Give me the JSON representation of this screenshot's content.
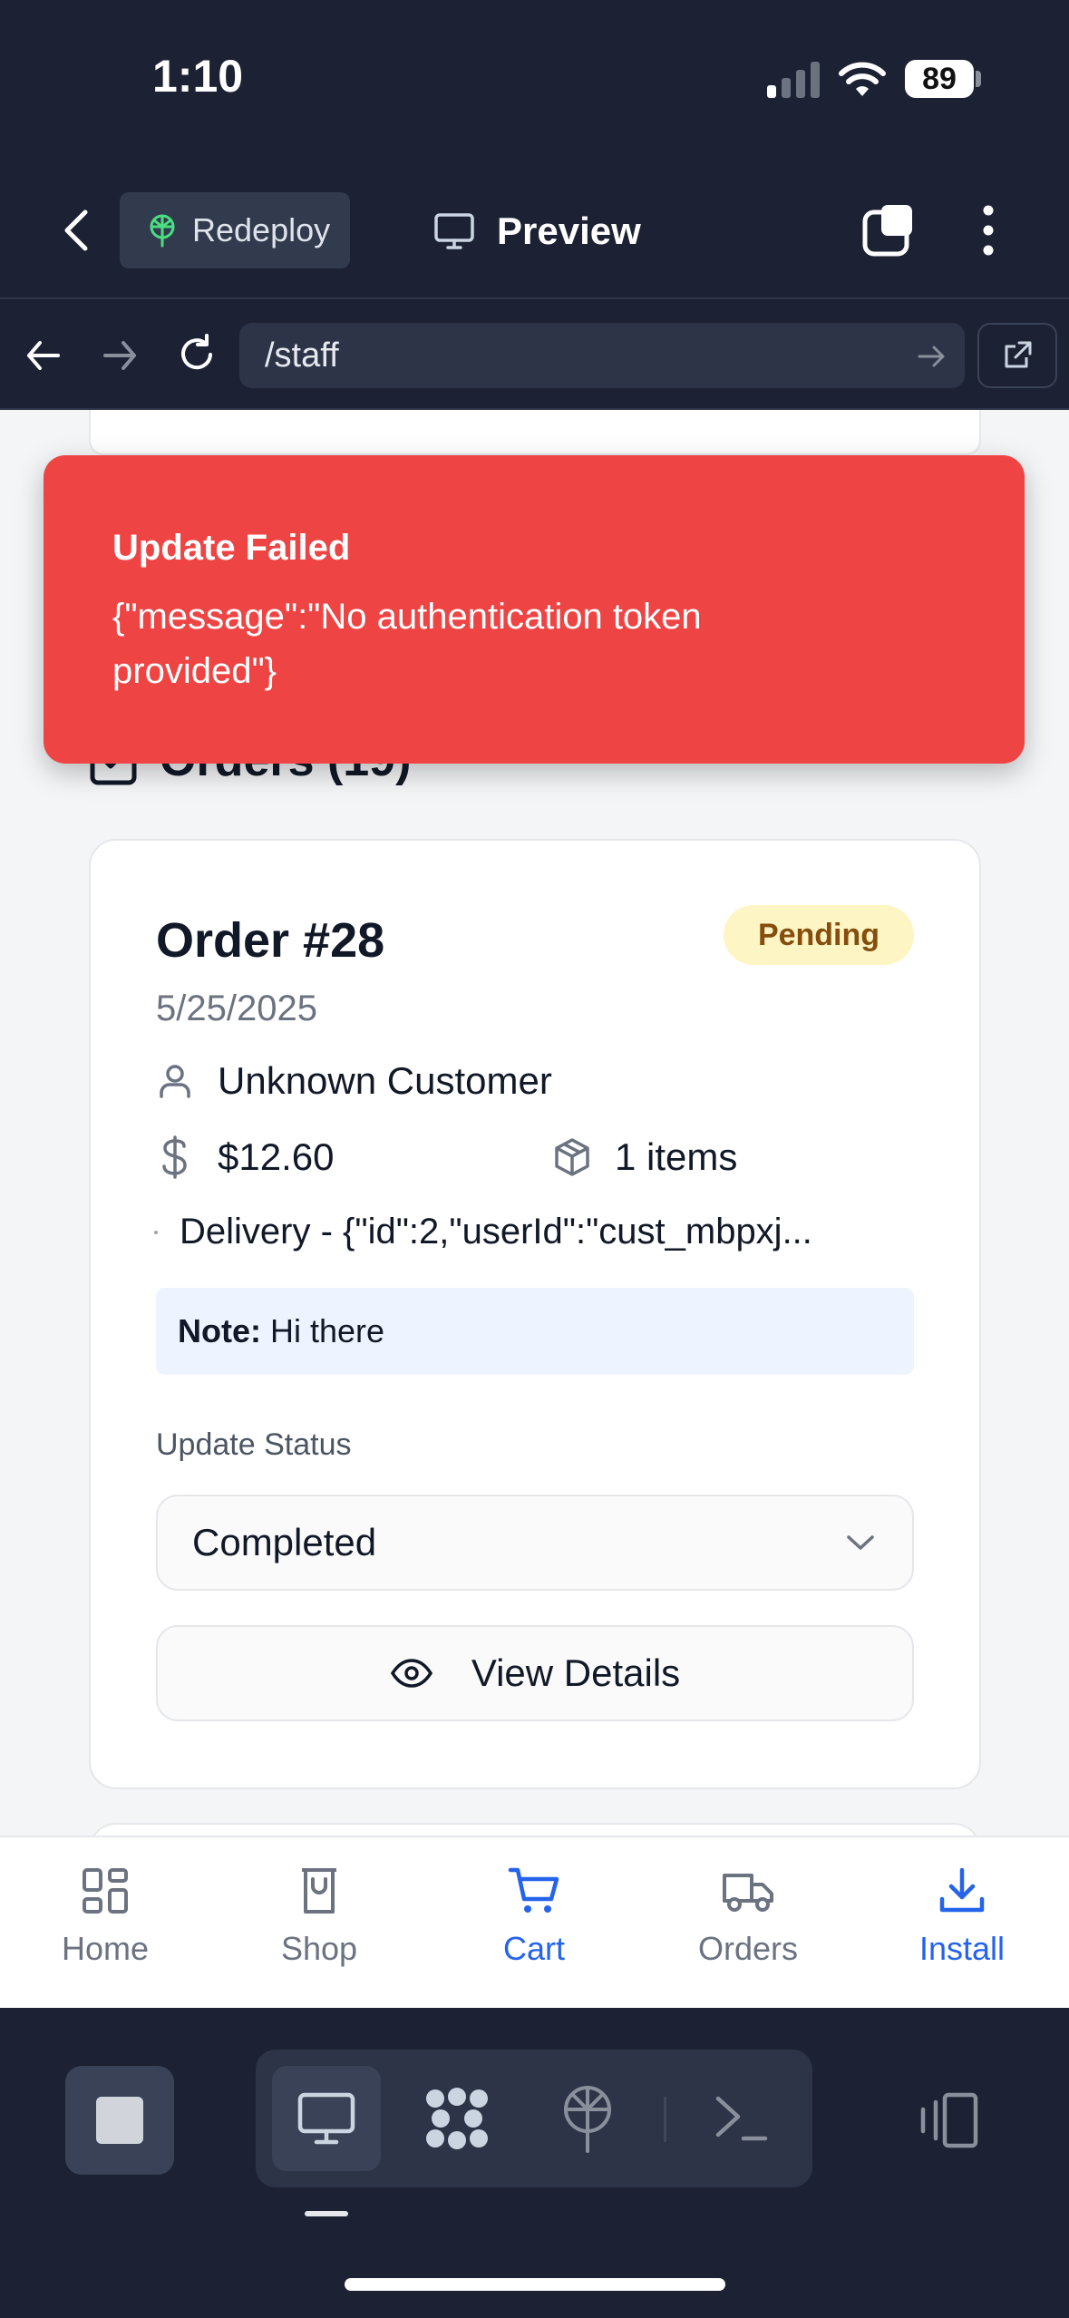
{
  "status_bar": {
    "time": "1:10",
    "battery": "89"
  },
  "toolbar": {
    "redeploy_label": "Redeploy",
    "preview_label": "Preview"
  },
  "url_bar": {
    "value": "/staff"
  },
  "toast": {
    "title": "Update Failed",
    "message": "{\"message\":\"No authentication token provided\"}"
  },
  "orders": {
    "heading": "Orders (19)"
  },
  "order": {
    "title": "Order #28",
    "status": "Pending",
    "date": "5/25/2025",
    "customer": "Unknown Customer",
    "total": "$12.60",
    "items": "1 items",
    "delivery": "Delivery - {\"id\":2,\"userId\":\"cust_mbpxj...",
    "note_label": "Note:",
    "note_text": "Hi there",
    "update_status_label": "Update Status",
    "selected_status": "Completed",
    "view_details_label": "View Details"
  },
  "bottom_nav": {
    "items": [
      {
        "label": "Home",
        "icon": "home-grid-icon"
      },
      {
        "label": "Shop",
        "icon": "shop-icon"
      },
      {
        "label": "Cart",
        "icon": "cart-icon"
      },
      {
        "label": "Orders",
        "icon": "truck-icon"
      },
      {
        "label": "Install",
        "icon": "download-icon"
      }
    ]
  },
  "colors": {
    "toast_bg": "#ef4444",
    "accent": "#2563eb",
    "pending_bg": "#fdf5c3",
    "pending_text": "#854d0e",
    "dark_chrome": "#1c2233"
  }
}
